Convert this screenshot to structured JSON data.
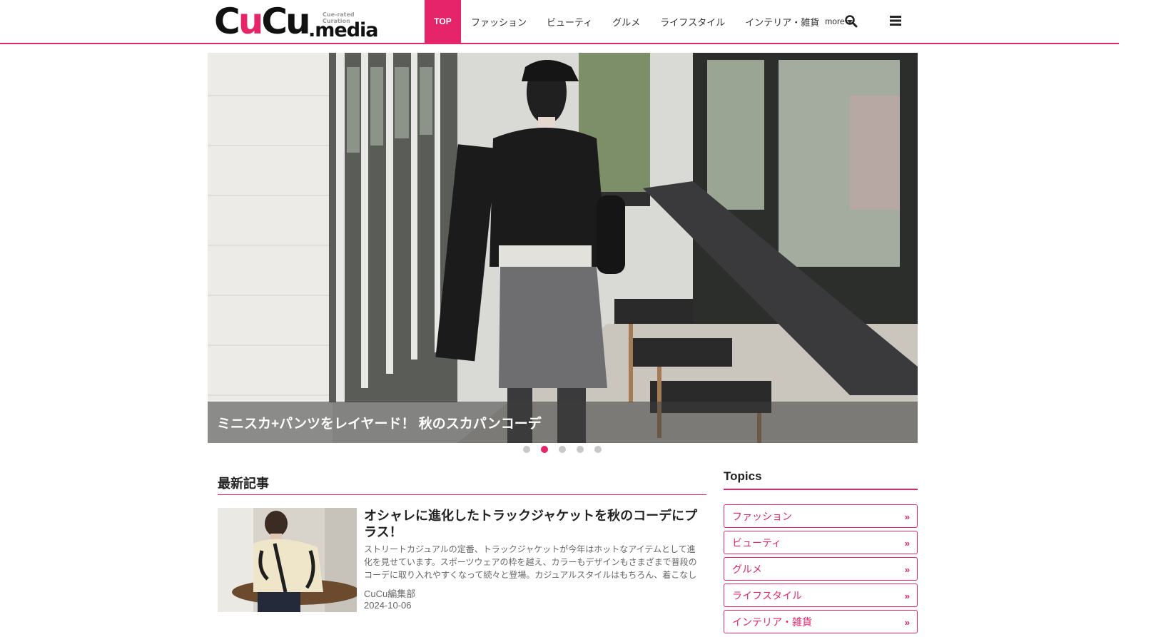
{
  "header": {
    "logo": {
      "cu1": "C",
      "u1": "u",
      "cu2": "C",
      "u2": "u",
      "sub": ".media",
      "tag": "Cue-rated Curation"
    },
    "nav": [
      {
        "label": "TOP"
      },
      {
        "label": "ファッション"
      },
      {
        "label": "ビューティ"
      },
      {
        "label": "グルメ"
      },
      {
        "label": "ライフスタイル"
      },
      {
        "label": "インテリア・雑貨"
      }
    ],
    "more_label": "more",
    "search_icon": "search-icon",
    "menu_icon": "hamburger-menu-icon",
    "accent_color": "#e5246a"
  },
  "hero": {
    "caption": "ミニスカ+パンツをレイヤード！ 秋のスカパンコーデ",
    "slide_count": 5,
    "active_slide": 2
  },
  "latest": {
    "heading": "最新記事",
    "articles": [
      {
        "title": "オシャレに進化したトラックジャケットを秋のコーデにプラス！",
        "description": "ストリートカジュアルの定番、トラックジャケットが今年はホットなアイテムとして進化を見せています。スポーツウェアの枠を越え、カラーもデザインもさまざまで普段のコーデに取り入れやすくなって続々と登場。カジュアルスタイルはもちろん、着こなし次第でモードな雰…",
        "author": "CuCu編集部",
        "date": "2024-10-06"
      }
    ]
  },
  "topics": {
    "heading": "Topics",
    "items": [
      {
        "label": "ファッション"
      },
      {
        "label": "ビューティ"
      },
      {
        "label": "グルメ"
      },
      {
        "label": "ライフスタイル"
      },
      {
        "label": "インテリア・雑貨"
      }
    ]
  }
}
